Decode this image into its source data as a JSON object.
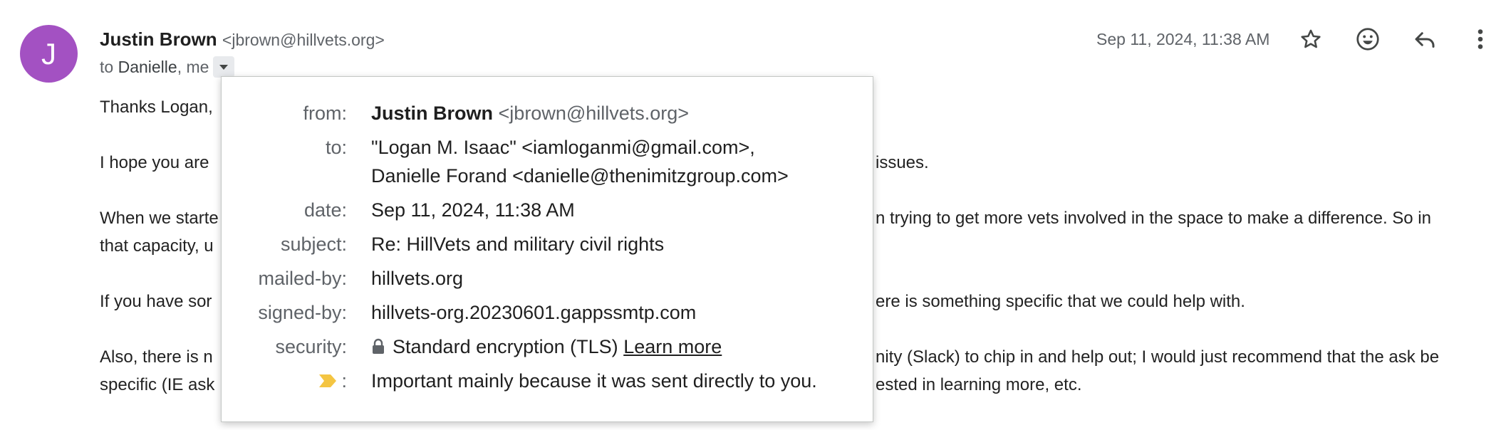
{
  "avatar": {
    "letter": "J",
    "color": "#a351c2"
  },
  "sender": {
    "name": "Justin Brown",
    "email": "<jbrown@hillvets.org>"
  },
  "recipients": {
    "prefix": "to",
    "names": "Danielle",
    "separator": ",",
    "me": "me"
  },
  "header": {
    "date": "Sep 11, 2024, 11:38 AM",
    "icons": [
      "star-icon",
      "emoji-icon",
      "reply-icon",
      "more-vert-icon"
    ]
  },
  "body": {
    "lines": [
      {
        "left": "Thanks Logan,",
        "right": ""
      },
      {
        "left": "I hope you are",
        "right": "issues."
      },
      {
        "left": "When we starte",
        "right": "n trying to get more vets involved in the space to make a difference. So in"
      },
      {
        "left": "that capacity, u",
        "right": ""
      },
      {
        "left": "If you have sor",
        "right": "ere is something specific that we could help with."
      },
      {
        "left": "Also, there is n",
        "right": "nity (Slack) to chip in and help out; I would just recommend that the ask be"
      },
      {
        "left": "specific (IE ask",
        "right": "ested in learning more, etc."
      }
    ]
  },
  "details_popup": {
    "from": {
      "label": "from:",
      "name": "Justin Brown",
      "email": "<jbrown@hillvets.org>"
    },
    "to": {
      "label": "to:",
      "line1": "\"Logan M. Isaac\" <iamloganmi@gmail.com>,",
      "line2": "Danielle Forand <danielle@thenimitzgroup.com>"
    },
    "date": {
      "label": "date:",
      "value": "Sep 11, 2024, 11:38 AM"
    },
    "subject": {
      "label": "subject:",
      "value": "Re: HillVets and military civil rights"
    },
    "mailed_by": {
      "label": "mailed-by:",
      "value": "hillvets.org"
    },
    "signed_by": {
      "label": "signed-by:",
      "value": "hillvets-org.20230601.gappssmtp.com"
    },
    "security": {
      "label": "security:",
      "value": "Standard encryption (TLS)",
      "link": "Learn more"
    },
    "importance": {
      "label_suffix": ":",
      "value": "Important mainly because it was sent directly to you.",
      "marker_color": "#f4c542"
    }
  }
}
